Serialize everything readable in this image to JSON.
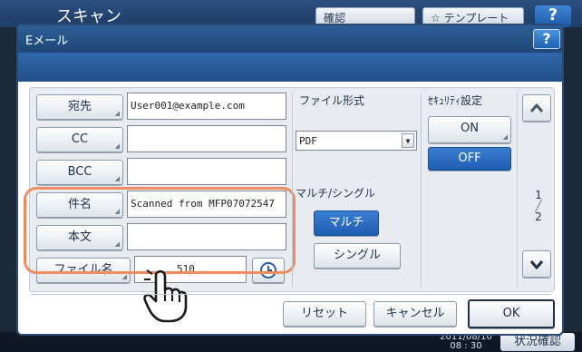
{
  "background": {
    "title": "スキャン",
    "confirm_button": "確認",
    "template_button": "☆ テンプレート",
    "help": "?",
    "datetime": "2011/08/10\n08 : 30",
    "status_button": "状況確認"
  },
  "dialog": {
    "title": "Eメール",
    "help": "?"
  },
  "address": {
    "to_label": "宛先",
    "to_value": "User001@example.com",
    "cc_label": "CC",
    "cc_value": "",
    "bcc_label": "BCC",
    "bcc_value": "",
    "subject_label": "件名",
    "subject_value": "Scanned from MFP07072547",
    "body_label": "本文",
    "body_value": "",
    "filename_label": "ファイル名",
    "filename_value": "510"
  },
  "file_format": {
    "label": "ファイル形式",
    "selected": "PDF"
  },
  "multi_single": {
    "label": "マルチ/シングル",
    "multi": "マルチ",
    "single": "シングル",
    "selected": "マルチ"
  },
  "security": {
    "label": "ｾｷｭﾘﾃｨ設定",
    "on": "ON",
    "off": "OFF",
    "selected": "OFF"
  },
  "pager": {
    "current": "1",
    "total": "2"
  },
  "footer": {
    "reset": "リセット",
    "cancel": "キャンセル",
    "ok": "OK"
  }
}
